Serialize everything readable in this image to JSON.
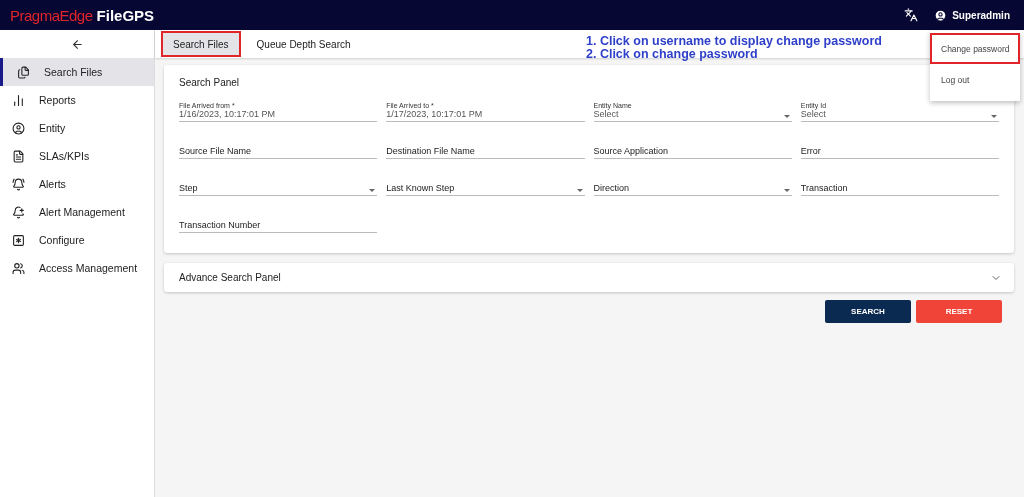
{
  "header": {
    "logo_brand": "PragmaEdge",
    "logo_product": "FileGPS",
    "user": "Superadmin"
  },
  "sidebar": {
    "items": [
      {
        "label": "Search Files",
        "selected": true
      },
      {
        "label": "Reports",
        "selected": false
      },
      {
        "label": "Entity",
        "selected": false
      },
      {
        "label": "SLAs/KPIs",
        "selected": false
      },
      {
        "label": "Alerts",
        "selected": false
      },
      {
        "label": "Alert Management",
        "selected": false
      },
      {
        "label": "Configure",
        "selected": false
      },
      {
        "label": "Access Management",
        "selected": false
      }
    ]
  },
  "tabs": [
    {
      "label": "Search Files",
      "selected": true,
      "highlighted": true
    },
    {
      "label": "Queue Depth Search",
      "selected": false,
      "highlighted": false
    }
  ],
  "instructions": [
    "1. Click on username to display change password",
    "2. Click on change password"
  ],
  "user_menu": [
    {
      "label": "Change password",
      "highlighted": true
    },
    {
      "label": "Log out",
      "highlighted": false
    }
  ],
  "search_panel": {
    "title": "Search Panel",
    "fields": [
      {
        "kind": "date",
        "label": "File Arrived from *",
        "value": "1/16/2023, 10:17:01 PM"
      },
      {
        "kind": "date",
        "label": "File Arrived to *",
        "value": "1/17/2023, 10:17:01 PM"
      },
      {
        "kind": "select",
        "label": "Entity Name",
        "value": "Select"
      },
      {
        "kind": "select",
        "label": "Entity Id",
        "value": "Select"
      },
      {
        "kind": "text",
        "placeholder": "Source File Name"
      },
      {
        "kind": "text",
        "placeholder": "Destination File Name"
      },
      {
        "kind": "text",
        "placeholder": "Source Application"
      },
      {
        "kind": "text",
        "placeholder": "Error"
      },
      {
        "kind": "select",
        "placeholder": "Step"
      },
      {
        "kind": "select",
        "placeholder": "Last Known Step"
      },
      {
        "kind": "select",
        "placeholder": "Direction"
      },
      {
        "kind": "text",
        "placeholder": "Transaction"
      },
      {
        "kind": "text",
        "placeholder": "Transaction Number"
      }
    ]
  },
  "advance_panel": {
    "title": "Advance Search Panel",
    "expanded": false
  },
  "buttons": [
    {
      "kind": "primary",
      "label": "SEARCH"
    },
    {
      "kind": "danger",
      "label": "RESET"
    }
  ]
}
